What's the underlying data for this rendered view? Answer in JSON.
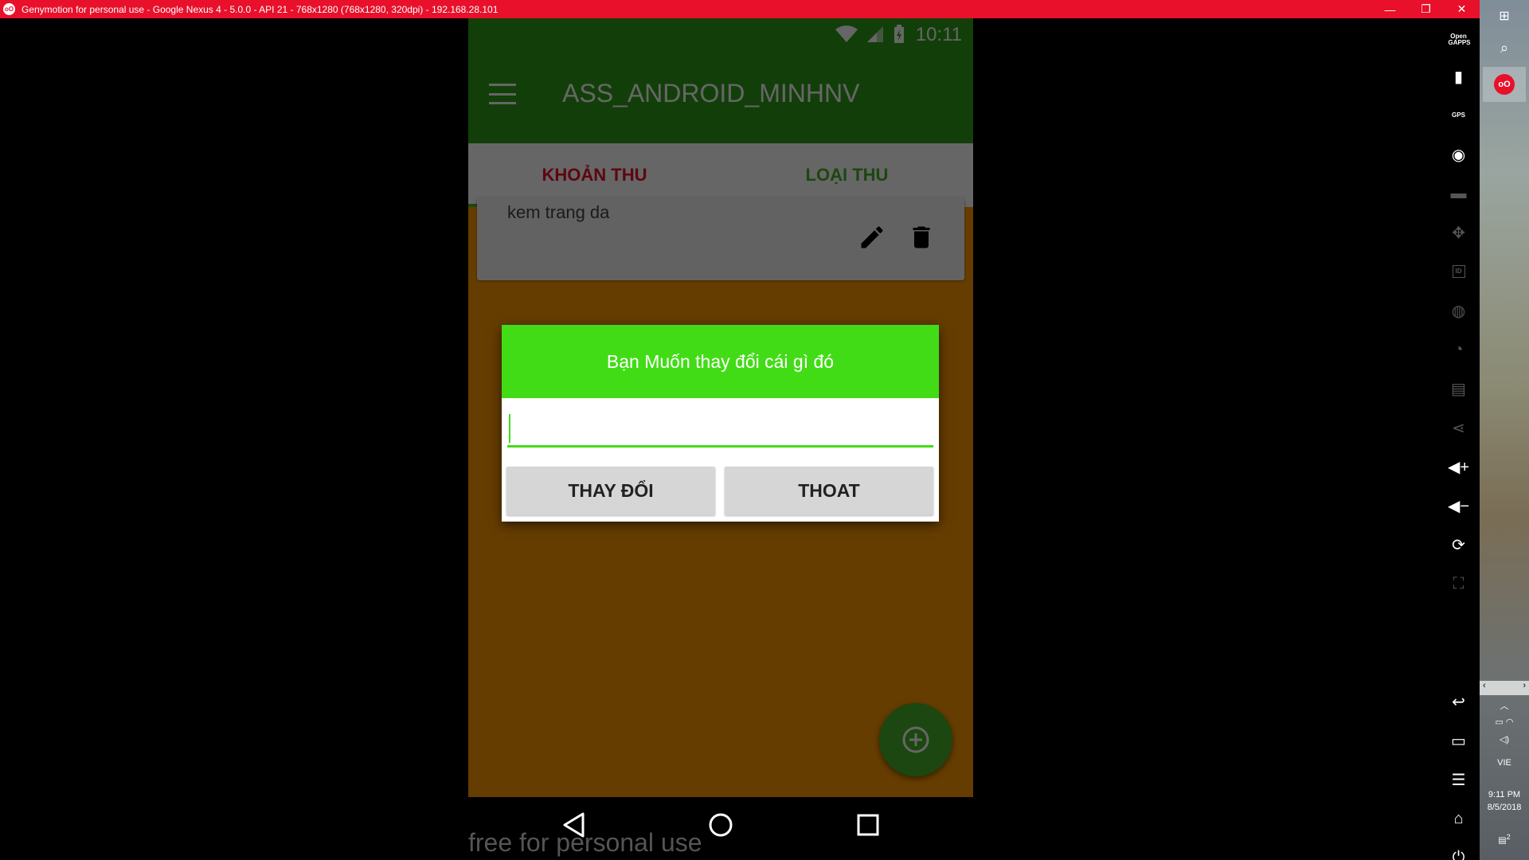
{
  "window": {
    "title": "Genymotion for personal use - Google Nexus 4 - 5.0.0 - API 21 - 768x1280 (768x1280, 320dpi) - 192.168.28.101",
    "minimize": "—",
    "restore": "❐",
    "close": "✕"
  },
  "statusbar": {
    "time": "10:11"
  },
  "appbar": {
    "title": "ASS_ANDROID_MINHNV"
  },
  "tabs": [
    {
      "label": "KHOẢN THU"
    },
    {
      "label": "LOẠI THU"
    }
  ],
  "list": [
    {
      "name": "kem trang da"
    }
  ],
  "dialog": {
    "title": "Bạn Muốn thay đổi cái gì đó",
    "input_value": "",
    "confirm_label": "THAY ĐỔI",
    "cancel_label": "THOAT"
  },
  "watermark": "free for personal use",
  "toolbar": {
    "opengapps_label": "Open GAPPS",
    "gps_label": "GPS",
    "id_label": "ID"
  },
  "taskbar": {
    "lang": "VIE",
    "time": "9:11 PM",
    "date": "8/5/2018",
    "notification_count": "2"
  },
  "colors": {
    "primary": "#2f9e18",
    "accent": "#46b12a",
    "dialog_header": "#42dc17",
    "background": "#ff9900",
    "active_tab": "#e8102a",
    "titlebar": "#e8102a"
  }
}
